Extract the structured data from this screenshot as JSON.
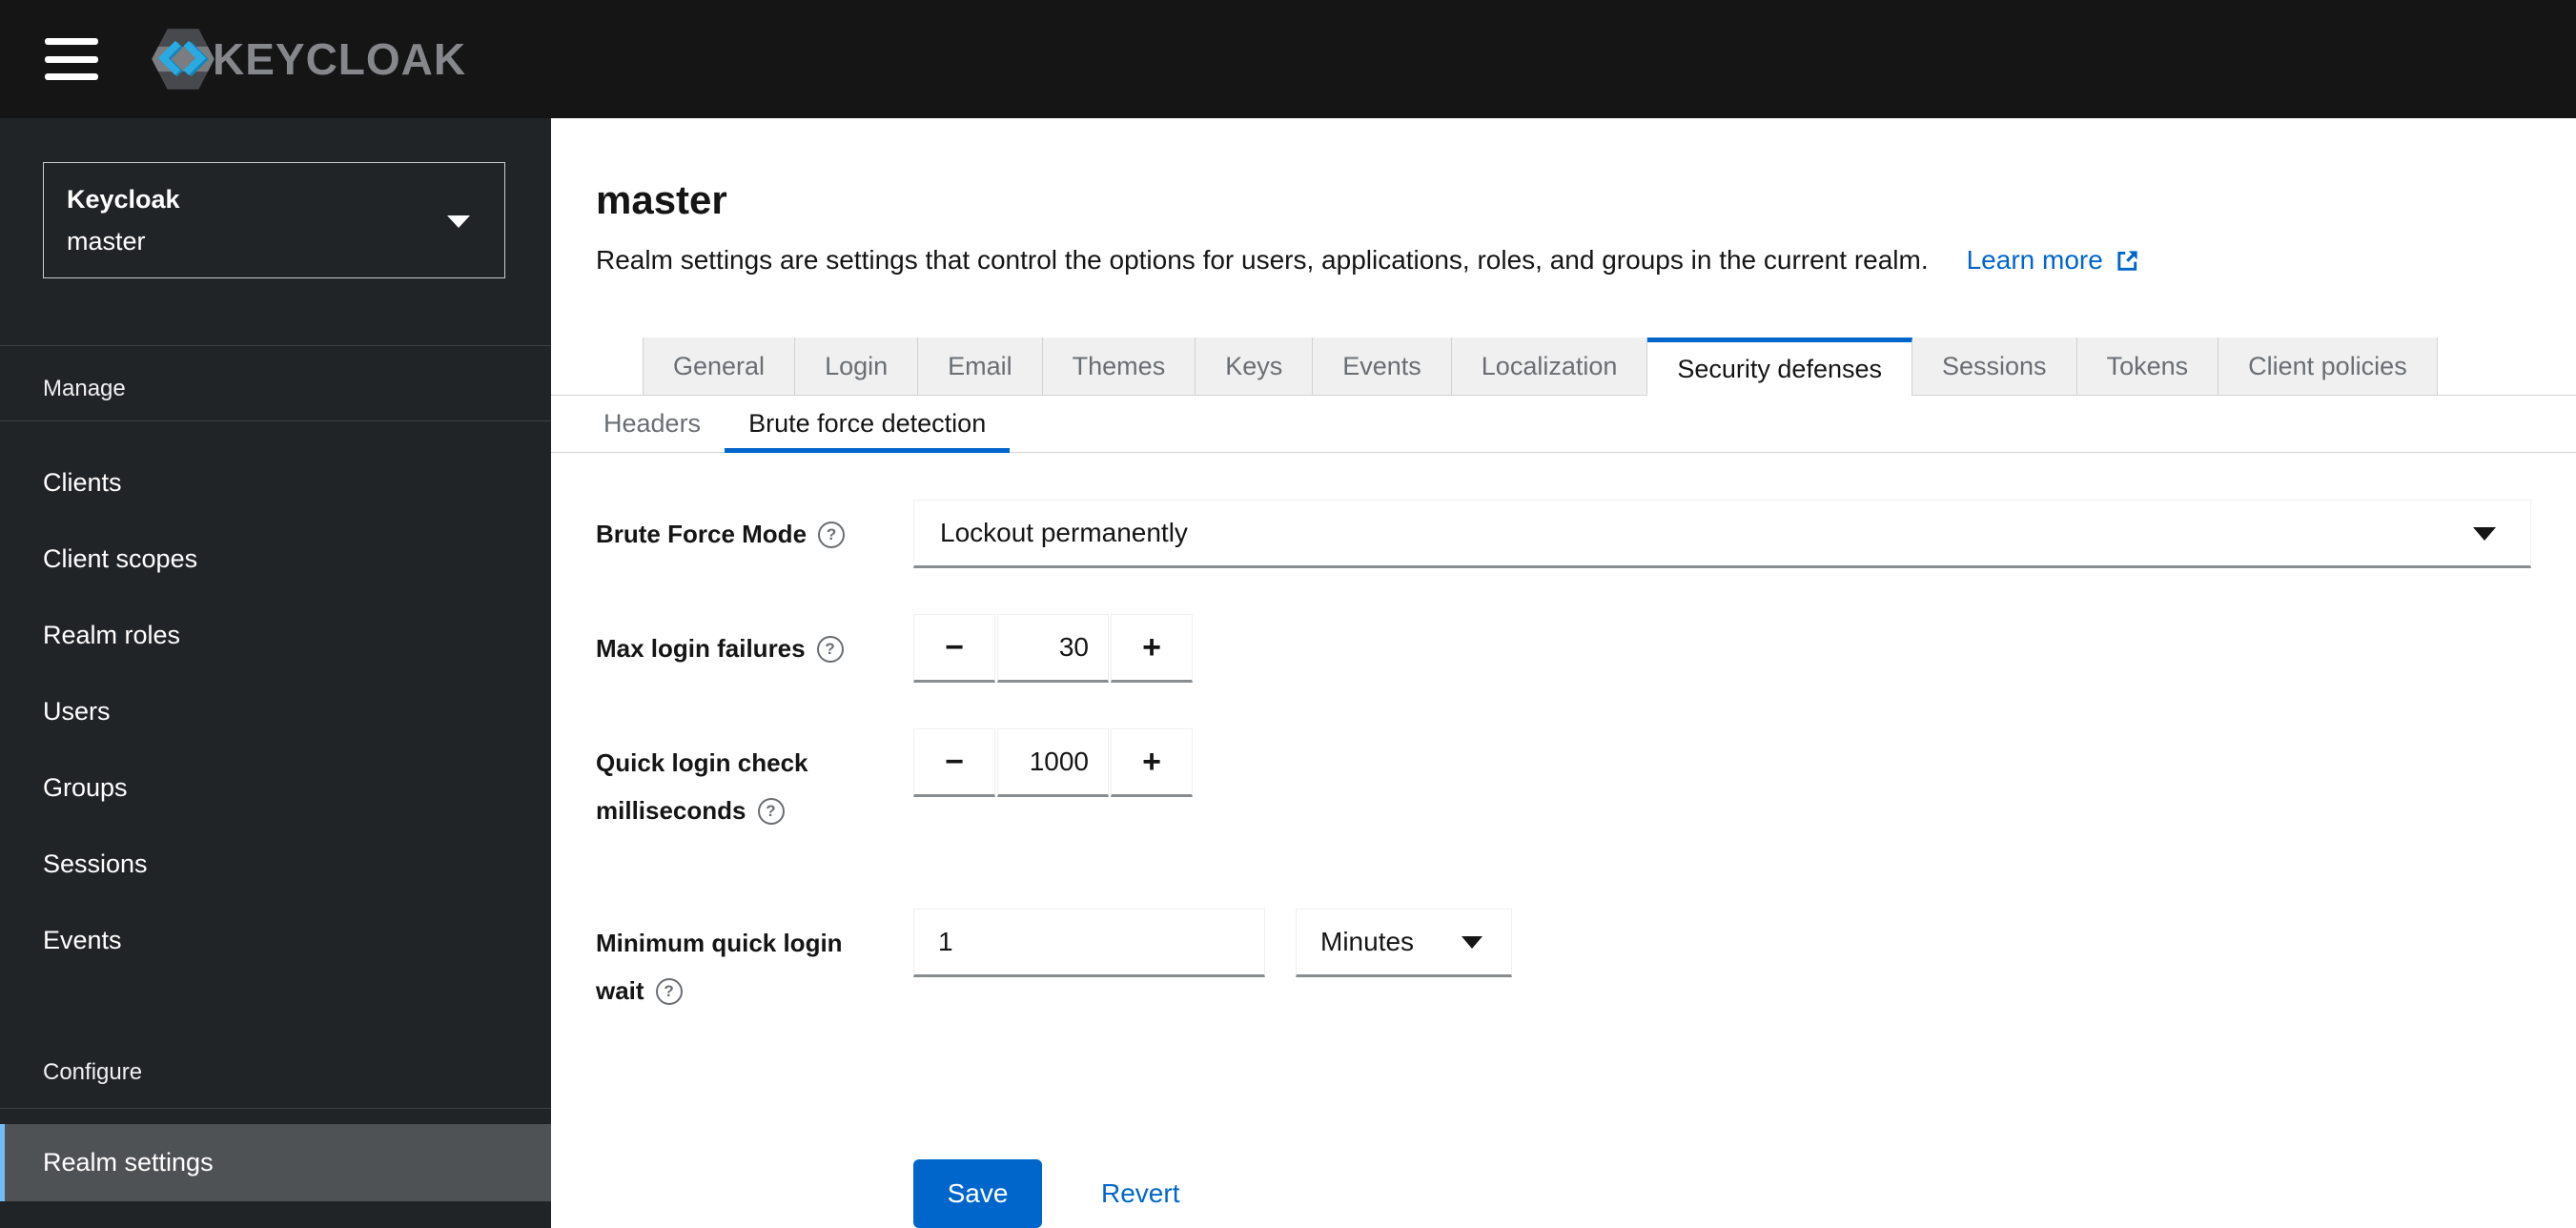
{
  "masthead": {
    "brand": "KEYCLOAK"
  },
  "sidebar": {
    "realm_switcher": {
      "title": "Keycloak",
      "current_realm": "master"
    },
    "sections": [
      {
        "title": "Manage",
        "items": [
          {
            "label": "Clients"
          },
          {
            "label": "Client scopes"
          },
          {
            "label": "Realm roles"
          },
          {
            "label": "Users"
          },
          {
            "label": "Groups"
          },
          {
            "label": "Sessions"
          },
          {
            "label": "Events"
          }
        ]
      },
      {
        "title": "Configure",
        "items": [
          {
            "label": "Realm settings",
            "active": true
          }
        ]
      }
    ]
  },
  "page": {
    "title": "master",
    "description": "Realm settings are settings that control the options for users, applications, roles, and groups in the current realm.",
    "learn_more": "Learn more",
    "tabs": [
      "General",
      "Login",
      "Email",
      "Themes",
      "Keys",
      "Events",
      "Localization",
      "Security defenses",
      "Sessions",
      "Tokens",
      "Client policies"
    ],
    "active_tab": "Security defenses",
    "subtabs": [
      "Headers",
      "Brute force detection"
    ],
    "active_subtab": "Brute force detection",
    "form": {
      "brute_force_mode": {
        "label": "Brute Force Mode",
        "value": "Lockout permanently"
      },
      "max_login_failures": {
        "label": "Max login failures",
        "value": "30"
      },
      "quick_login_check": {
        "label_line1": "Quick login check",
        "label_line2": "milliseconds",
        "value": "1000"
      },
      "min_quick_login_wait": {
        "label_line1": "Minimum quick login",
        "label_line2": "wait",
        "value": "1",
        "unit": "Minutes"
      }
    },
    "actions": {
      "save": "Save",
      "revert": "Revert"
    }
  },
  "icons": {
    "help": "?",
    "minus": "−",
    "plus": "+"
  },
  "colors": {
    "accent_blue": "#0066cc",
    "masthead_bg": "#151515",
    "sidebar_bg": "#212427",
    "nav_active_bg": "#4f5255",
    "nav_active_indicator": "#73bcf7",
    "tab_inactive_bg": "#f0f0f0",
    "tab_inactive_text": "#6a6e73",
    "field_bottom_border": "#8a8d90",
    "logo_chevron_blue": "#29abe2"
  }
}
